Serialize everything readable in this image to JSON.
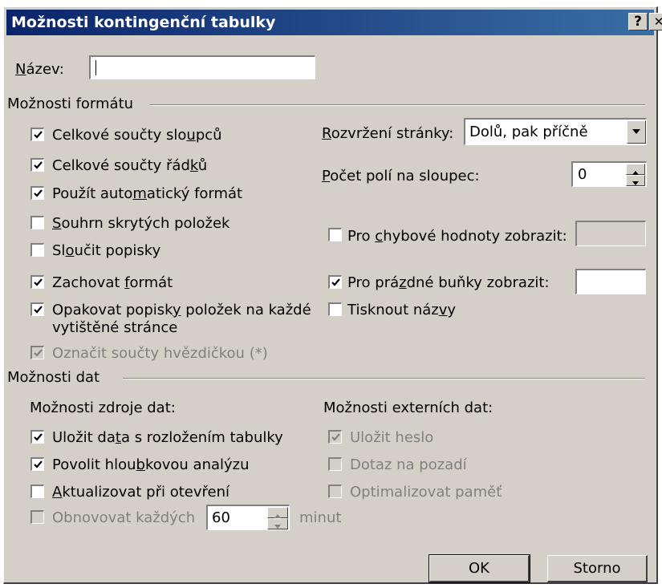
{
  "window": {
    "title": "Možnosti kontingenční tabulky",
    "help_button": "?",
    "close_button": "✕"
  },
  "name_field": {
    "label_pre": "",
    "label_u": "N",
    "label_post": "ázev:",
    "value": ""
  },
  "format_section": {
    "title": "Možnosti formátu",
    "checkboxes": [
      {
        "pre": "Celkové součty slo",
        "u": "u",
        "post": "pců",
        "checked": true,
        "disabled": false
      },
      {
        "pre": "Celkové součty řád",
        "u": "k",
        "post": "ů",
        "checked": true,
        "disabled": false
      },
      {
        "pre": "Použít auto",
        "u": "m",
        "post": "atický formát",
        "checked": true,
        "disabled": false
      },
      {
        "pre": "",
        "u": "S",
        "post": "ouhrn skrytých položek",
        "checked": false,
        "disabled": false
      },
      {
        "pre": "Sl",
        "u": "o",
        "post": "učit popisky",
        "checked": false,
        "disabled": false
      },
      {
        "pre": "Zachovat ",
        "u": "f",
        "post": "ormát",
        "checked": true,
        "disabled": false
      },
      {
        "pre": "Opakovat popisk",
        "u": "y",
        "post": " položek na každé",
        "line2": "vytištěné stránce",
        "checked": true,
        "disabled": false
      },
      {
        "pre": "Označit součty hvězdičkou (*)",
        "u": "",
        "post": "",
        "checked": true,
        "disabled": true
      }
    ],
    "page_layout": {
      "label_pre": "",
      "label_u": "R",
      "label_post": "ozvržení stránky:",
      "value": "Dolů, pak příčně"
    },
    "fields_per_column": {
      "label_pre": "",
      "label_u": "P",
      "label_post": "očet polí na sloupec:",
      "value": "0"
    },
    "error_values": {
      "pre": "Pro ",
      "u": "c",
      "post": "hybové hodnoty zobrazit:",
      "checked": false,
      "value": ""
    },
    "empty_cells": {
      "pre": "Pro prá",
      "u": "z",
      "post": "dné buňky zobrazit:",
      "checked": true,
      "value": ""
    },
    "print_titles": {
      "pre": "Tisknout náz",
      "u": "v",
      "post": "y",
      "checked": false
    }
  },
  "data_section": {
    "title": "Možnosti dat",
    "source_title": "Možnosti zdroje dat:",
    "source_checkboxes": [
      {
        "pre": "Uložit da",
        "u": "t",
        "post": "a s rozložením tabulky",
        "checked": true,
        "disabled": false
      },
      {
        "pre": "Povolit hlou",
        "u": "b",
        "post": "kovou analýzu",
        "checked": true,
        "disabled": false
      },
      {
        "pre": "",
        "u": "A",
        "post": "ktualizovat při otevření",
        "checked": false,
        "disabled": false
      }
    ],
    "refresh": {
      "label": "Obnovovat každých",
      "value": "60",
      "unit": "minut",
      "checked": false,
      "disabled": true
    },
    "external_title": "Možnosti externích dat:",
    "external_checkboxes": [
      {
        "pre": "Uložit heslo",
        "u": "",
        "post": "",
        "checked": true,
        "disabled": true
      },
      {
        "pre": "Dotaz na pozadí",
        "u": "",
        "post": "",
        "checked": false,
        "disabled": true
      },
      {
        "pre": "Optimalizovat paměť",
        "u": "",
        "post": "",
        "checked": false,
        "disabled": true
      }
    ]
  },
  "buttons": {
    "ok": "OK",
    "cancel": "Storno"
  }
}
